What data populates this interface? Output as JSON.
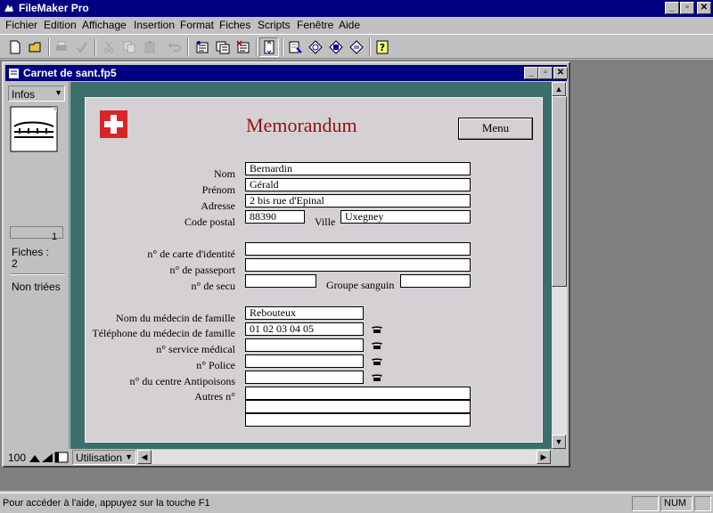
{
  "app": {
    "title": "FileMaker Pro",
    "controls": {
      "minimize": "_",
      "maximize": "▫",
      "close": "✕"
    }
  },
  "menu": [
    "Fichier",
    "Edition",
    "Affichage",
    "Insertion",
    "Format",
    "Fiches",
    "Scripts",
    "Fenêtre",
    "Aide"
  ],
  "toolbar": [
    {
      "icon": "new-icon",
      "enabled": true
    },
    {
      "icon": "open-icon",
      "enabled": true
    },
    {
      "icon": "print-icon",
      "enabled": false
    },
    {
      "icon": "spellcheck-icon",
      "enabled": false
    },
    {
      "icon": "cut-icon",
      "enabled": false
    },
    {
      "icon": "copy-icon",
      "enabled": false
    },
    {
      "icon": "paste-icon",
      "enabled": false
    },
    {
      "icon": "undo-icon",
      "enabled": false
    },
    {
      "icon": "new-record-icon",
      "enabled": true
    },
    {
      "icon": "duplicate-record-icon",
      "enabled": true
    },
    {
      "icon": "delete-record-icon",
      "enabled": true
    },
    {
      "icon": "sort-icon",
      "enabled": true
    },
    {
      "icon": "browse-mode-icon",
      "enabled": true
    },
    {
      "icon": "find-mode-icon",
      "enabled": true
    },
    {
      "icon": "layout-mode-icon",
      "enabled": true
    },
    {
      "icon": "preview-mode-icon",
      "enabled": true
    },
    {
      "icon": "help-icon",
      "enabled": true
    }
  ],
  "document": {
    "title": "Carnet de sant.fp5",
    "layout_selector": "Infos",
    "page_number": "1",
    "records_label": "Fiches :",
    "records_count": "2",
    "sort_status": "Non triées",
    "zoom": "100",
    "mode": "Utilisation"
  },
  "form": {
    "title": "Memorandum",
    "menu_button": "Menu",
    "labels": {
      "nom": "Nom",
      "prenom": "Prénom",
      "adresse": "Adresse",
      "code_postal": "Code postal",
      "ville": "Ville",
      "carte_identite": "n° de carte d'identité",
      "passeport": "n° de passeport",
      "secu": "n° de secu",
      "groupe_sanguin": "Groupe sanguin",
      "medecin_nom": "Nom du médecin de famille",
      "medecin_tel": "Téléphone du médecin de famille",
      "service_medical": "n° service médical",
      "police": "n° Police",
      "antipoisons": "n° du centre Antipoisons",
      "autres": "Autres n°"
    },
    "values": {
      "nom": "Bernardin",
      "prenom": "Gérald",
      "adresse": "2 bis rue d'Epinal",
      "code_postal": "88390",
      "ville": "Uxegney",
      "carte_identite": "",
      "passeport": "",
      "secu": "",
      "groupe_sanguin": "",
      "medecin_nom": "Rebouteux",
      "medecin_tel": "01 02 03 04 05",
      "service_medical": "",
      "police": "",
      "antipoisons": "",
      "autres_1": "",
      "autres_2": "",
      "autres_3": ""
    },
    "colors": {
      "teal_background": "#3a6f6c",
      "card": "#d4d0d4",
      "title": "#9a1010",
      "swiss_red": "#d9252a"
    }
  },
  "statusbar": {
    "text": "Pour accéder à l'aide, appuyez sur la touche F1",
    "num": "NUM"
  }
}
